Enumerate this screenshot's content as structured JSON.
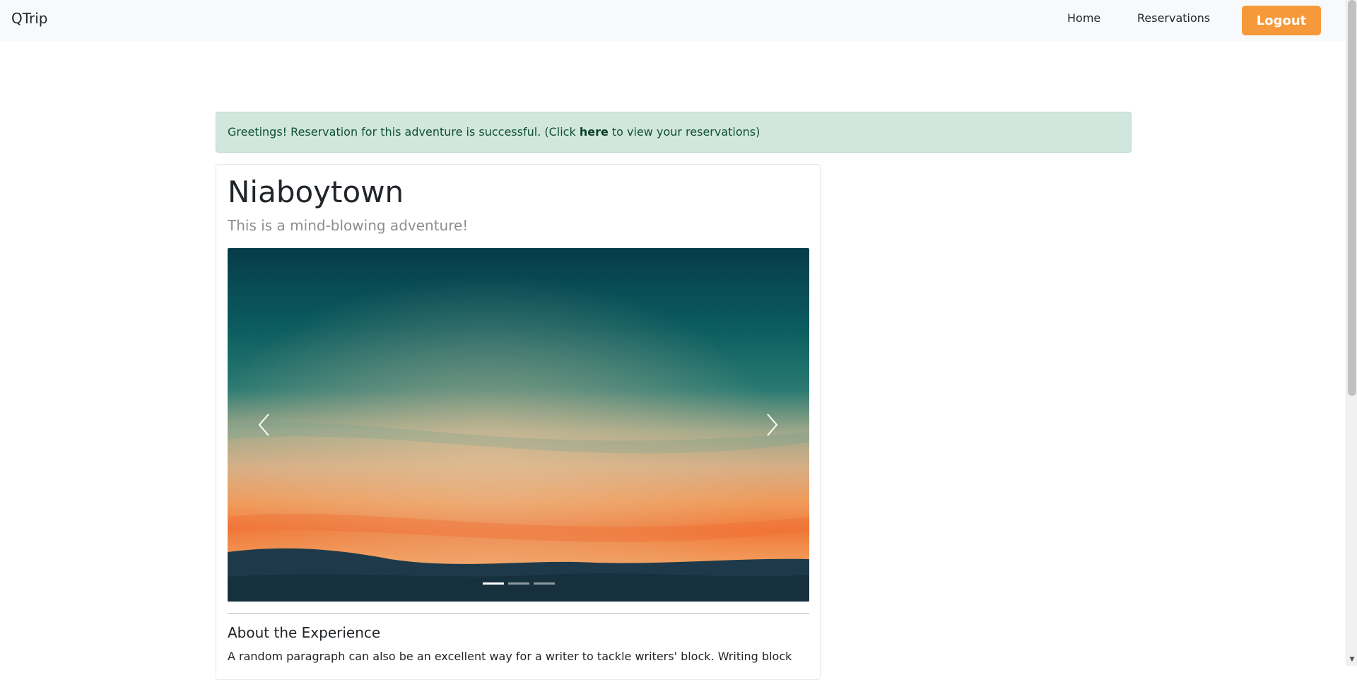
{
  "navbar": {
    "brand": "QTrip",
    "links": [
      {
        "label": "Home"
      },
      {
        "label": "Reservations"
      }
    ],
    "logout_label": "Logout"
  },
  "alert": {
    "prefix": "Greetings! Reservation for this adventure is successful. (Click ",
    "link_text": "here",
    "suffix": " to view your reservations)"
  },
  "adventure": {
    "name": "Niaboytown",
    "subtitle": "This is a mind-blowing adventure!",
    "carousel": {
      "slide_count": 3,
      "active_index": 0
    },
    "about_heading": "About the Experience",
    "about_text": "A random paragraph can also be an excellent way for a writer to tackle writers' block. Writing block"
  },
  "colors": {
    "navbar_bg": "#f8f9fa",
    "logout_bg": "#f6993a",
    "alert_bg": "#d1e7dd",
    "alert_text": "#0f5132"
  }
}
